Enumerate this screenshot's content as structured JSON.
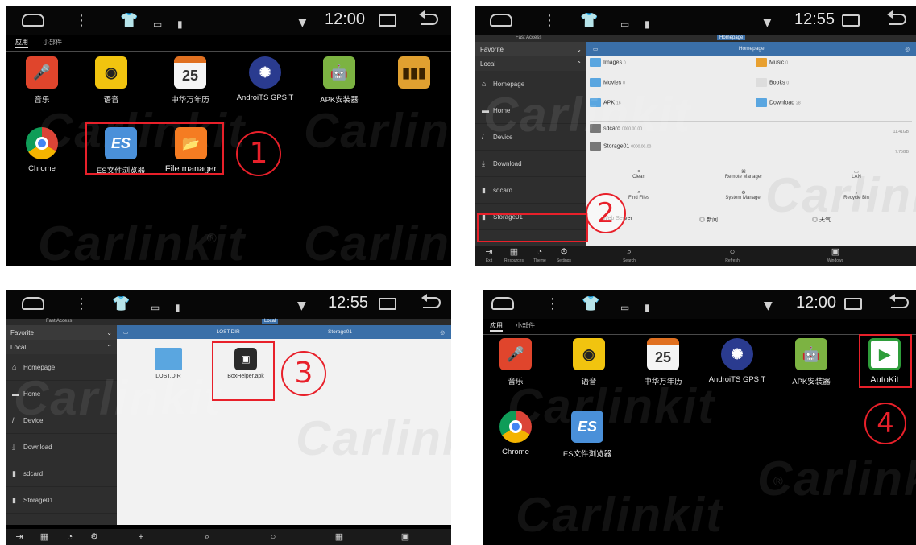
{
  "watermark": "Carlinkit",
  "p1": {
    "time": "12:00",
    "tabs": [
      "应用",
      "小部件"
    ],
    "apps": [
      {
        "label": "音乐",
        "icon": "microphone-icon",
        "color": "#e0452c"
      },
      {
        "label": "语音",
        "icon": "voice-icon",
        "color": "#f1c40f"
      },
      {
        "label": "中华万年历",
        "icon": "calendar-icon",
        "color": "#f5f5f5",
        "num": "25"
      },
      {
        "label": "AndroiTS GPS T",
        "icon": "gps-icon",
        "color": "#2a3b8f"
      },
      {
        "label": "APK安装器",
        "icon": "android-icon",
        "color": "#7cb342"
      },
      {
        "label": "",
        "icon": "equalizer-icon",
        "color": "#e0a030"
      },
      {
        "label": "Chrome",
        "icon": "chrome-icon",
        "color": "#4285f4"
      },
      {
        "label": "ES文件浏览器",
        "icon": "es-file-icon",
        "color": "#4a90d9",
        "es": "ES"
      },
      {
        "label": "File manager",
        "icon": "folder-icon",
        "color": "#f57c22"
      }
    ],
    "step": "1"
  },
  "p2": {
    "time": "12:55",
    "fast_access": "Fast Access",
    "path_chip": "Homepage",
    "sidebar": {
      "favorite": "Favorite",
      "local": "Local",
      "items": [
        "Homepage",
        "Home",
        "Device",
        "Download",
        "sdcard",
        "Storage01"
      ]
    },
    "path_title": "Homepage",
    "categories": [
      {
        "name": "Images",
        "count": "0"
      },
      {
        "name": "Music",
        "count": "0"
      },
      {
        "name": "Movies",
        "count": "0"
      },
      {
        "name": "Books",
        "count": "0"
      },
      {
        "name": "APK",
        "count": "16"
      },
      {
        "name": "Download",
        "count": "28"
      }
    ],
    "storage": [
      {
        "name": "sdcard",
        "sub": "0000.00.00",
        "size": "11.41GB"
      },
      {
        "name": "Storage01",
        "sub": "0000.00.00",
        "size": "7.75GB"
      }
    ],
    "tools": [
      "Clean",
      "Remote Manager",
      "LAN",
      "Find Files",
      "System Manager",
      "Recycle Bin"
    ],
    "extras": [
      "Web Server",
      "新闻",
      "天气"
    ],
    "bottom": [
      "Exit",
      "Resources",
      "Theme",
      "Settings",
      "Search",
      "Refresh",
      "Windows"
    ],
    "step": "2"
  },
  "p3": {
    "time": "12:55",
    "fast_access": "Fast Access",
    "path_chip": "Local",
    "sidebar": {
      "favorite": "Favorite",
      "local": "Local",
      "items": [
        "Homepage",
        "Home",
        "Device",
        "Download",
        "sdcard",
        "Storage01"
      ]
    },
    "path_left": "LOST.DIR",
    "path_right": "Storage01",
    "files": [
      {
        "name": "LOST.DIR",
        "type": "folder"
      },
      {
        "name": "BoxHelper.apk",
        "type": "apk"
      }
    ],
    "step": "3"
  },
  "p4": {
    "time": "12:00",
    "tabs": [
      "应用",
      "小部件"
    ],
    "apps": [
      {
        "label": "音乐",
        "icon": "microphone-icon",
        "color": "#e0452c"
      },
      {
        "label": "语音",
        "icon": "voice-icon",
        "color": "#f1c40f"
      },
      {
        "label": "中华万年历",
        "icon": "calendar-icon",
        "color": "#f5f5f5",
        "num": "25"
      },
      {
        "label": "AndroiTS GPS T",
        "icon": "gps-icon",
        "color": "#2a3b8f"
      },
      {
        "label": "APK安装器",
        "icon": "android-icon",
        "color": "#7cb342"
      },
      {
        "label": "AutoKit",
        "icon": "autokit-icon",
        "color": "#ffffff"
      },
      {
        "label": "Chrome",
        "icon": "chrome-icon",
        "color": "#4285f4"
      },
      {
        "label": "ES文件浏览器",
        "icon": "es-file-icon",
        "color": "#4a90d9",
        "es": "ES"
      }
    ],
    "step": "4"
  }
}
